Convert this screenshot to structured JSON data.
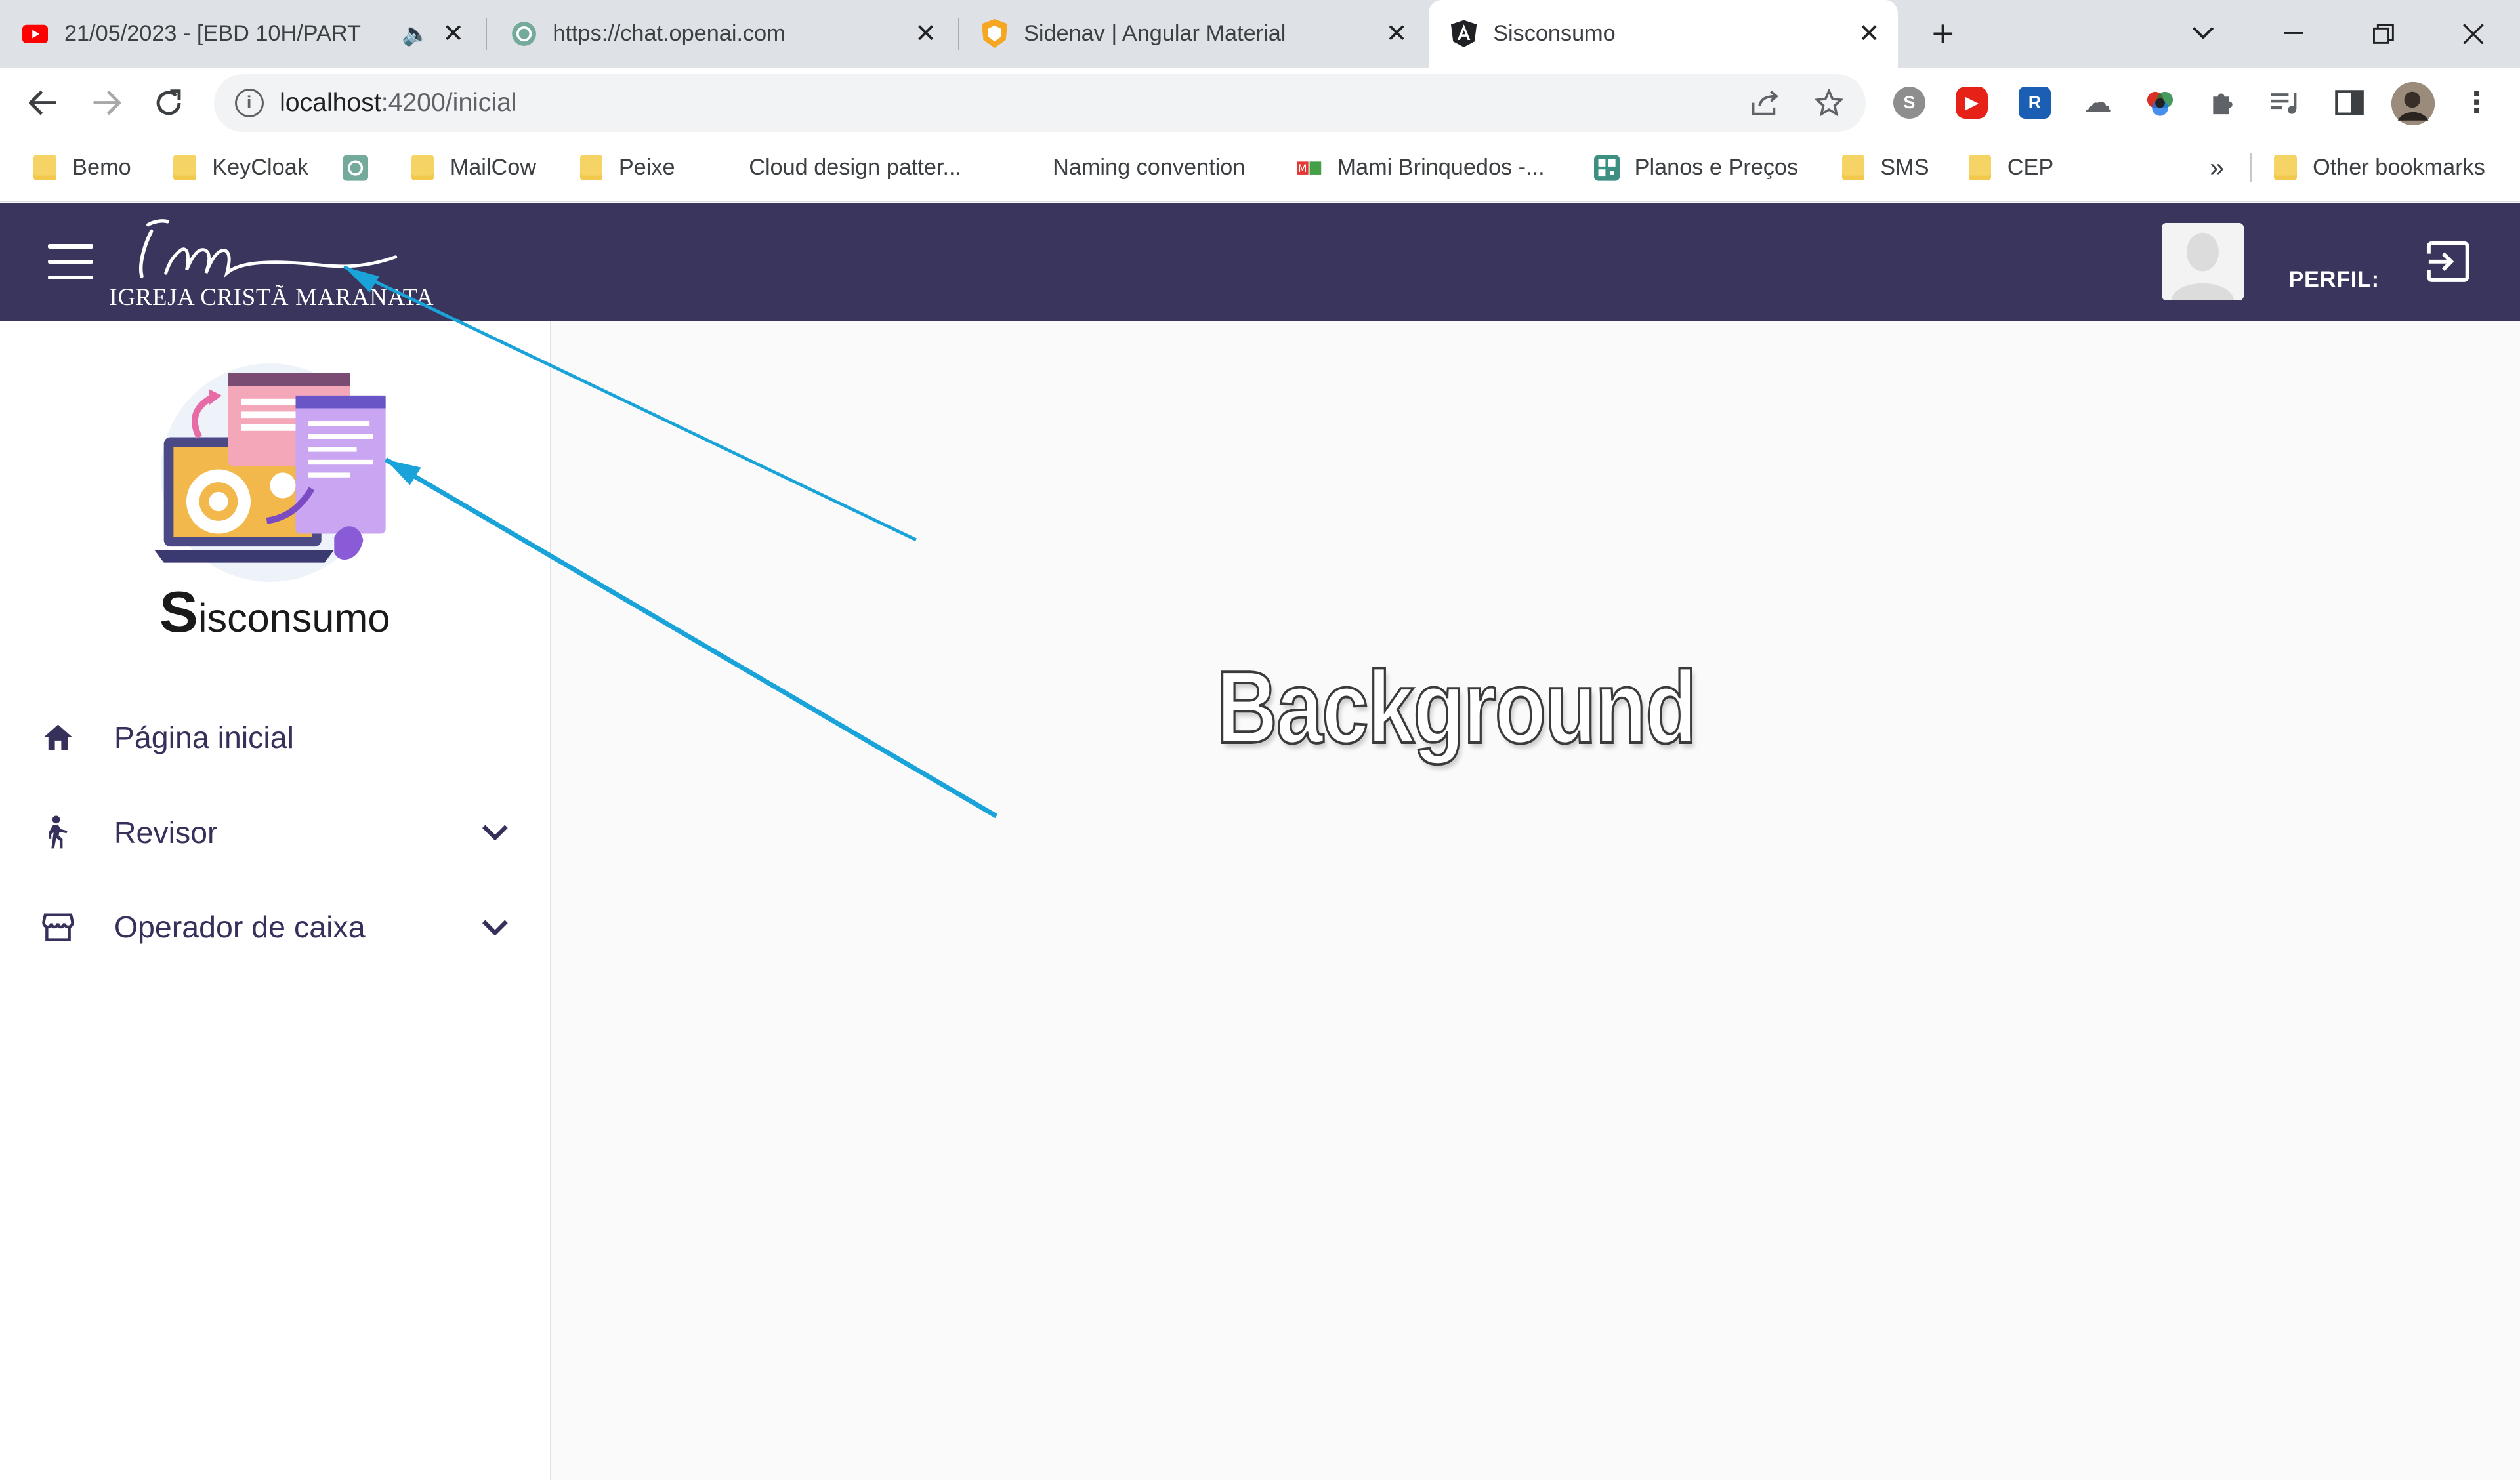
{
  "browser": {
    "tabs": [
      {
        "title": "21/05/2023 - [EBD 10H/PART",
        "favicon": "youtube-icon",
        "audio": true
      },
      {
        "title": "https://chat.openai.com",
        "favicon": "openai-icon"
      },
      {
        "title": "Sidenav | Angular Material",
        "favicon": "angular-material-icon"
      },
      {
        "title": "Sisconsumo",
        "favicon": "angular-icon",
        "active": true
      }
    ],
    "url_host": "localhost",
    "url_rest": ":4200/inicial",
    "bookmarks": [
      "Bemo",
      "KeyCloak",
      "",
      "MailCow",
      "Peixe",
      "Cloud design patter...",
      "Naming convention",
      "Mami Brinquedos -...",
      "Planos e Preços",
      "SMS",
      "CEP"
    ],
    "other_bookmarks": "Other bookmarks",
    "overflow": "»"
  },
  "header": {
    "logo_script": "im",
    "logo_text": "IGREJA CRISTÃ MARANATA",
    "profile_label": "PERFIL:"
  },
  "sidenav": {
    "brand_initial": "S",
    "brand_rest": "isconsumo",
    "items": [
      {
        "label": "Página inicial",
        "icon": "home-icon"
      },
      {
        "label": "Revisor",
        "icon": "person-icon",
        "expandable": true
      },
      {
        "label": "Operador de caixa",
        "icon": "store-icon",
        "expandable": true
      }
    ]
  },
  "content": {
    "annotation": "Background"
  },
  "colors": {
    "appbar": "#3a355d",
    "nav_text": "#35315a",
    "arrow": "#1aa3d8"
  }
}
